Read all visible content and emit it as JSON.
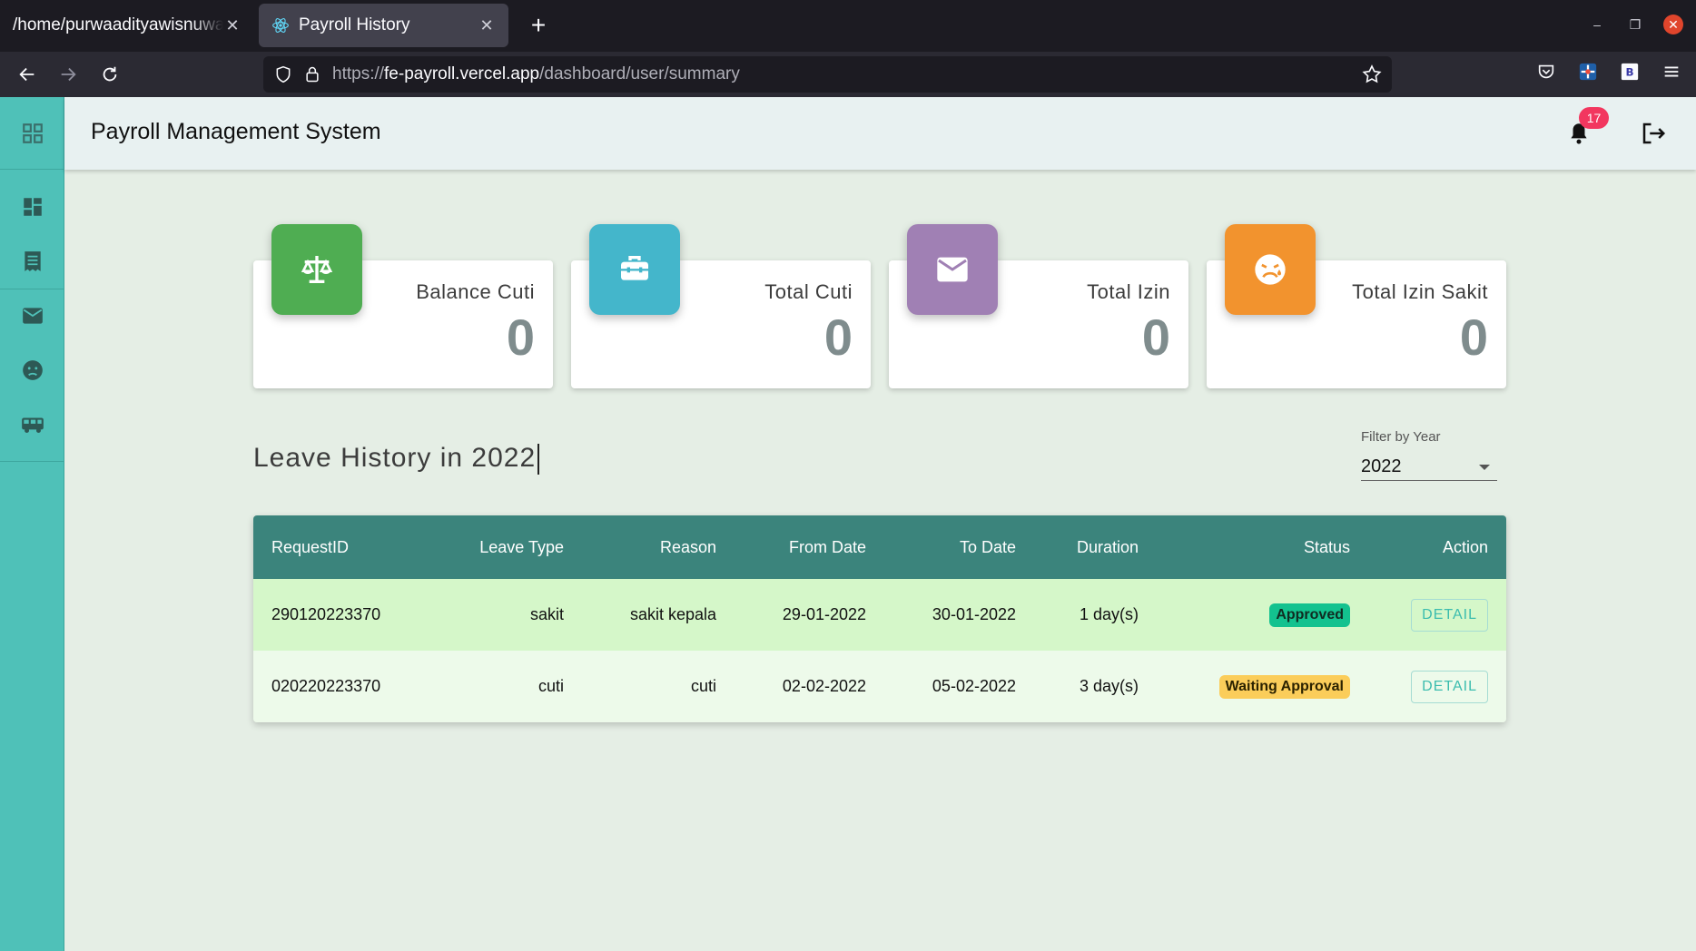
{
  "browser": {
    "tabs": [
      {
        "title": "/home/purwaadityawisnuwardana"
      },
      {
        "title": "Payroll History"
      }
    ],
    "url_prefix": "https://",
    "url_host": "fe-payroll.vercel.app",
    "url_path": "/dashboard/user/summary"
  },
  "app": {
    "title": "Payroll Management System",
    "notification_count": "17",
    "sidebar_icons": [
      "apps-icon",
      "dashboard-icon",
      "receipt-icon",
      "mail-icon",
      "sick-icon",
      "bus-icon"
    ]
  },
  "cards": [
    {
      "label": "Balance Cuti",
      "value": "0",
      "color": "#4fad52",
      "icon": "scale-icon"
    },
    {
      "label": "Total Cuti",
      "value": "0",
      "color": "#44b6cb",
      "icon": "toolbox-icon"
    },
    {
      "label": "Total Izin",
      "value": "0",
      "color": "#a080b4",
      "icon": "mail-icon"
    },
    {
      "label": "Total Izin Sakit",
      "value": "0",
      "color": "#f2932e",
      "icon": "sick-face-icon"
    }
  ],
  "section": {
    "title": "Leave History in 2022"
  },
  "filter": {
    "label": "Filter by Year",
    "value": "2022"
  },
  "table": {
    "headers": [
      "RequestID",
      "Leave Type",
      "Reason",
      "From Date",
      "To Date",
      "Duration",
      "Status",
      "Action"
    ],
    "rows": [
      {
        "id": "290120223370",
        "type": "sakit",
        "reason": "sakit kepala",
        "from": "29-01-2022",
        "to": "30-01-2022",
        "duration": "1 day(s)",
        "status": "Approved",
        "action": "DETAIL"
      },
      {
        "id": "020220223370",
        "type": "cuti",
        "reason": "cuti",
        "from": "02-02-2022",
        "to": "05-02-2022",
        "duration": "3 day(s)",
        "status": "Waiting Approval",
        "action": "DETAIL"
      }
    ]
  }
}
